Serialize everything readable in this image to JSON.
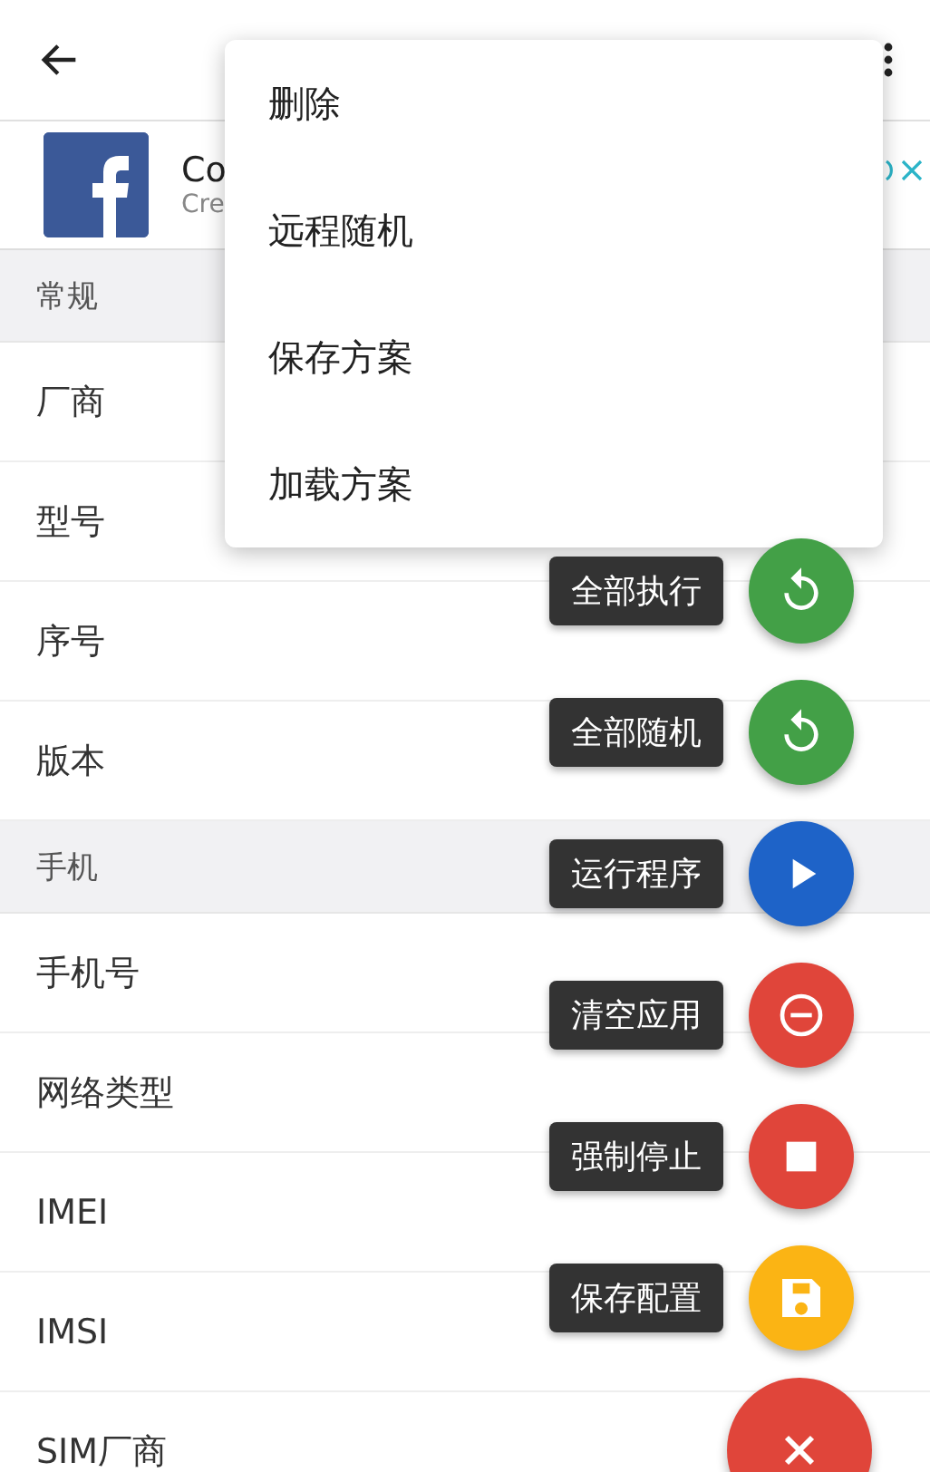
{
  "ad": {
    "title": "Co",
    "subtitle": "Cre"
  },
  "sections": [
    {
      "header": "常规",
      "rows": [
        "厂商",
        "型号",
        "序号",
        "版本"
      ]
    },
    {
      "header": "手机",
      "rows": [
        "手机号",
        "网络类型",
        "IMEI",
        "IMSI",
        "SIM厂商"
      ]
    }
  ],
  "menu": [
    "删除",
    "远程随机",
    "保存方案",
    "加载方案"
  ],
  "fabs": [
    {
      "label": "全部执行",
      "kind": "refresh",
      "color": "#43a047"
    },
    {
      "label": "全部随机",
      "kind": "refresh",
      "color": "#43a047"
    },
    {
      "label": "运行程序",
      "kind": "play",
      "color": "#1e63c8"
    },
    {
      "label": "清空应用",
      "kind": "remove",
      "color": "#e0453a"
    },
    {
      "label": "强制停止",
      "kind": "stop",
      "color": "#e0453a"
    },
    {
      "label": "保存配置",
      "kind": "save",
      "color": "#fbb414"
    }
  ],
  "main_fab": {
    "kind": "close",
    "color": "#e0453a"
  }
}
